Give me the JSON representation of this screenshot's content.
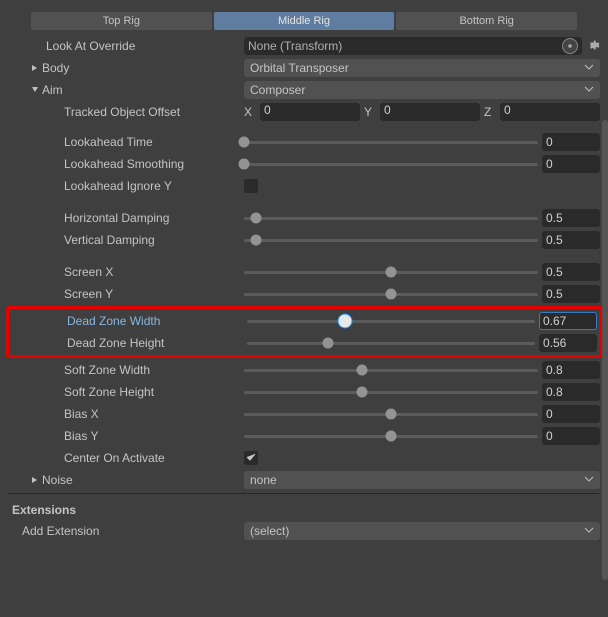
{
  "tabs": {
    "top": "Top Rig",
    "middle": "Middle Rig",
    "bottom": "Bottom Rig",
    "active": "middle"
  },
  "lookAtOverride": {
    "label": "Look At Override",
    "value": "None (Transform)"
  },
  "body": {
    "label": "Body",
    "value": "Orbital Transposer"
  },
  "aim": {
    "label": "Aim",
    "value": "Composer"
  },
  "trackedOffset": {
    "label": "Tracked Object Offset",
    "x": "0",
    "y": "0",
    "z": "0"
  },
  "sliders": {
    "lookaheadTime": {
      "label": "Lookahead Time",
      "value": "0",
      "t": 0.0
    },
    "lookaheadSmoothing": {
      "label": "Lookahead Smoothing",
      "value": "0",
      "t": 0.0
    },
    "lookaheadIgnoreY": {
      "label": "Lookahead Ignore Y",
      "checked": false
    },
    "horizontalDamping": {
      "label": "Horizontal Damping",
      "value": "0.5",
      "t": 0.04
    },
    "verticalDamping": {
      "label": "Vertical Damping",
      "value": "0.5",
      "t": 0.04
    },
    "screenX": {
      "label": "Screen X",
      "value": "0.5",
      "t": 0.5
    },
    "screenY": {
      "label": "Screen Y",
      "value": "0.5",
      "t": 0.5
    },
    "deadZoneWidth": {
      "label": "Dead Zone Width",
      "value": "0.67",
      "t": 0.34
    },
    "deadZoneHeight": {
      "label": "Dead Zone Height",
      "value": "0.56",
      "t": 0.28
    },
    "softZoneWidth": {
      "label": "Soft Zone Width",
      "value": "0.8",
      "t": 0.4
    },
    "softZoneHeight": {
      "label": "Soft Zone Height",
      "value": "0.8",
      "t": 0.4
    },
    "biasX": {
      "label": "Bias X",
      "value": "0",
      "t": 0.5
    },
    "biasY": {
      "label": "Bias Y",
      "value": "0",
      "t": 0.5
    },
    "centerOnActivate": {
      "label": "Center On Activate",
      "checked": true
    }
  },
  "noise": {
    "label": "Noise",
    "value": "none"
  },
  "extensions": {
    "header": "Extensions",
    "addLabel": "Add Extension",
    "addValue": "(select)"
  }
}
